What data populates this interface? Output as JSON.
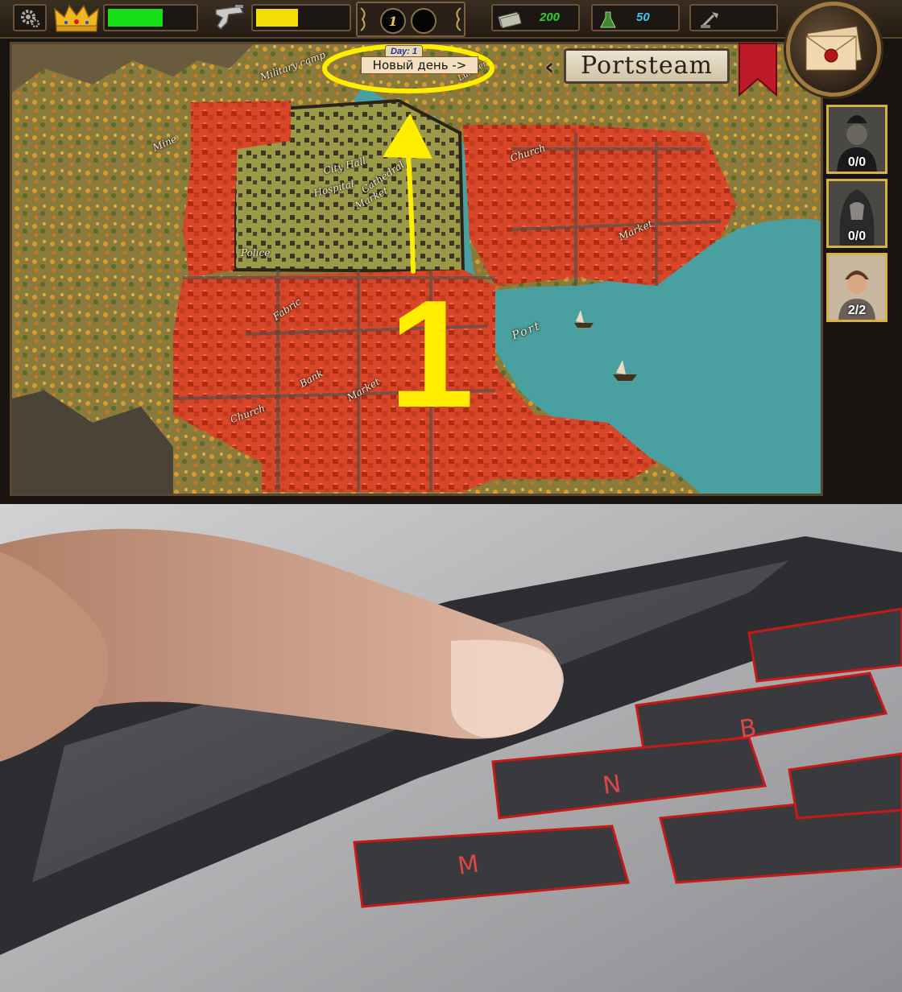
{
  "hud": {
    "settings_icon": "gear-icon",
    "health_bar_fill": 0.62,
    "health_color": "#18e018",
    "ammo_bar_fill": 0.45,
    "ammo_color": "#f4dc08",
    "slot_left": "1",
    "slot_right": "",
    "money": "200",
    "money_color": "#30d030",
    "potion": "50",
    "potion_color": "#40c8f0",
    "tool_value": ""
  },
  "map": {
    "day_label": "Day: 1",
    "new_day_button": "Новый день ->",
    "city_name": "Portsteam",
    "districts": {
      "military_camp": "Military camp",
      "lumber": "Lumber",
      "mine": "Mine",
      "city_hall": "City Hall",
      "hospital": "Hospital",
      "cathedral": "Cathedral",
      "market_center": "Market",
      "church_east": "Church",
      "market_east": "Market",
      "police": "Police",
      "fabric": "Fabric",
      "bank": "Bank",
      "market_south": "Market",
      "church_west": "Church",
      "port": "Port"
    },
    "annotation_number": "1"
  },
  "agents": [
    {
      "count": "0/0"
    },
    {
      "count": "0/0"
    },
    {
      "count": "2/2"
    }
  ],
  "colors": {
    "district_red": "#d8462a",
    "water": "#4aa0a0",
    "annotation_yellow": "#ffee00"
  }
}
